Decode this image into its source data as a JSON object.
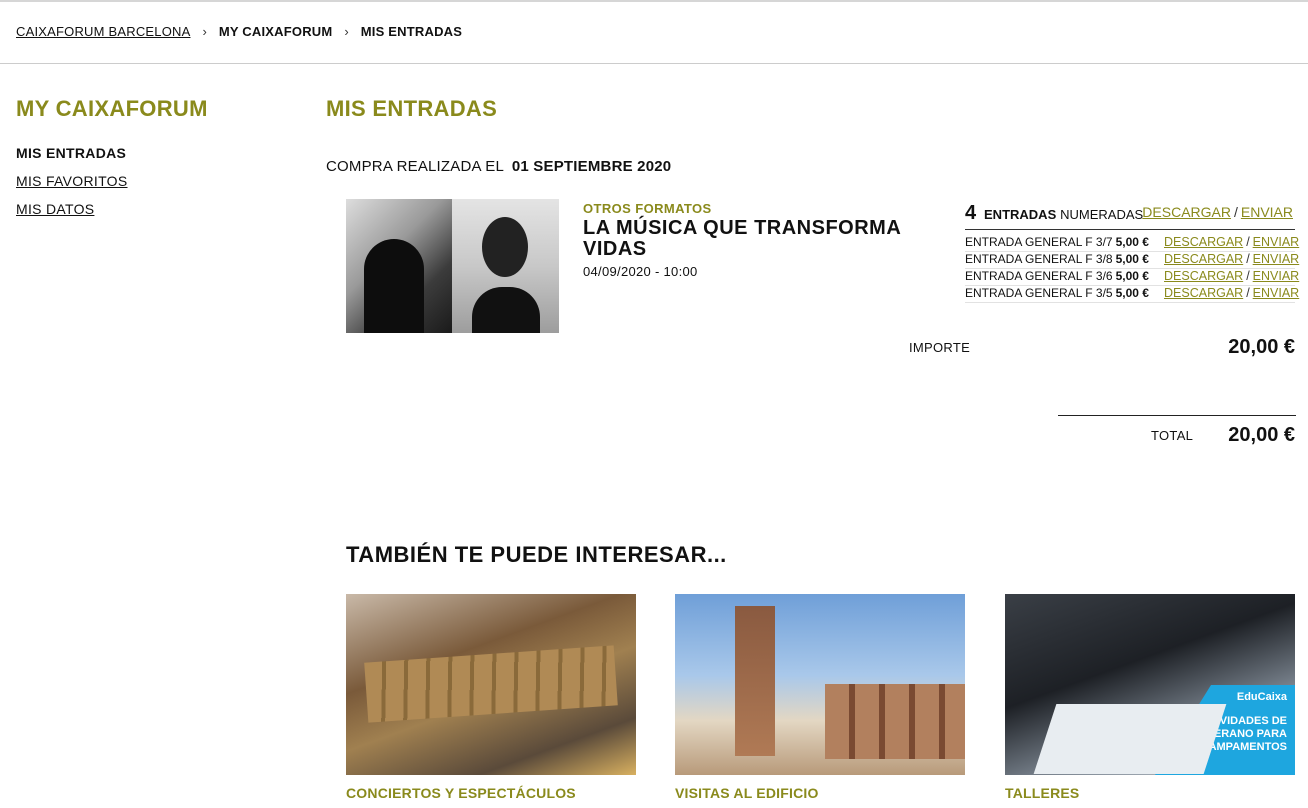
{
  "breadcrumb": {
    "items": [
      "CAIXAFORUM BARCELONA",
      "MY CAIXAFORUM",
      "MIS ENTRADAS"
    ],
    "separator": "›"
  },
  "sidebar": {
    "title": "MY CAIXAFORUM",
    "items": [
      "MIS ENTRADAS",
      "MIS FAVORITOS",
      "MIS DATOS"
    ]
  },
  "main": {
    "title": "MIS ENTRADAS",
    "purchase_label": "COMPRA REALIZADA EL",
    "purchase_date": "01 SEPTIEMBRE 2020"
  },
  "event": {
    "category": "OTROS FORMATOS",
    "name": "LA MÚSICA QUE TRANSFORMA VIDAS",
    "datetime": "04/09/2020 - 10:00"
  },
  "tickets": {
    "count": "4",
    "label_bold": "ENTRADAS",
    "label": "NUMERADAS",
    "download": "DESCARGAR",
    "send": "ENVIAR",
    "slash": "/",
    "rows": [
      {
        "name": "ENTRADA GENERAL F 3/7",
        "price": "5,00 €"
      },
      {
        "name": "ENTRADA GENERAL F 3/8",
        "price": "5,00 €"
      },
      {
        "name": "ENTRADA GENERAL F 3/6",
        "price": "5,00 €"
      },
      {
        "name": "ENTRADA GENERAL F 3/5",
        "price": "5,00 €"
      }
    ]
  },
  "summary": {
    "importe_label": "IMPORTE",
    "importe_value": "20,00 €",
    "total_label": "TOTAL",
    "total_value": "20,00 €"
  },
  "recommendations": {
    "title": "TAMBIÉN TE PUEDE INTERESAR...",
    "cards": [
      {
        "label": "CONCIERTOS Y ESPECTÁCULOS"
      },
      {
        "label": "VISITAS AL EDIFICIO"
      },
      {
        "label": "TALLERES",
        "badge_brand": "EduCaixa",
        "badge_text": "ACTIVIDADES DE VERANO PARA CAMPAMENTOS"
      }
    ]
  },
  "colors": {
    "accent": "#8a8a1c",
    "badge": "#1ea6df"
  }
}
